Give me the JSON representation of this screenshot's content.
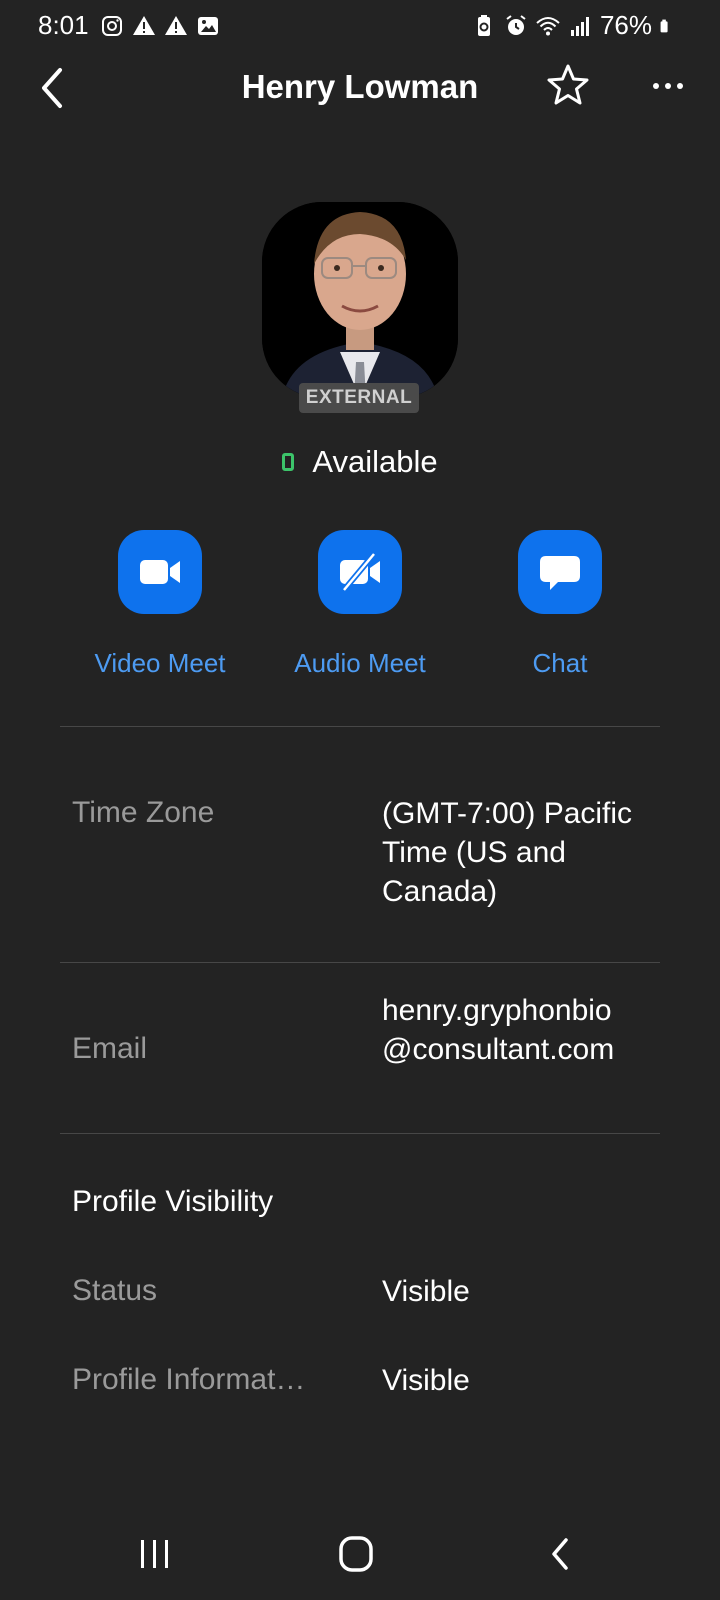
{
  "status_bar": {
    "time": "8:01",
    "battery": "76%",
    "left_icons": [
      "instagram-icon",
      "warning-icon",
      "warning-icon",
      "image-icon"
    ],
    "right_icons": [
      "battery-saver-icon",
      "alarm-icon",
      "wifi-icon",
      "signal-icon",
      "battery-icon"
    ]
  },
  "header": {
    "title": "Henry Lowman"
  },
  "profile": {
    "badge": "EXTERNAL",
    "availability": "Available",
    "availability_color": "#3cc46a"
  },
  "actions": [
    {
      "label": "Video Meet",
      "icon": "video-camera-icon"
    },
    {
      "label": "Audio Meet",
      "icon": "video-off-icon"
    },
    {
      "label": "Chat",
      "icon": "chat-bubble-icon"
    }
  ],
  "details": {
    "time_zone": {
      "label": "Time Zone",
      "value": "(GMT-7:00) Pacific Time (US and Canada)"
    },
    "email": {
      "label": "Email",
      "value": "henry.gryphonbio@consultant.com"
    }
  },
  "visibility": {
    "title": "Profile Visibility",
    "rows": [
      {
        "label": "Status",
        "value": "Visible"
      },
      {
        "label": "Profile Informat…",
        "value": "Visible"
      }
    ]
  },
  "colors": {
    "background": "#232323",
    "accent": "#0e72ed",
    "link": "#4d9bf2"
  }
}
